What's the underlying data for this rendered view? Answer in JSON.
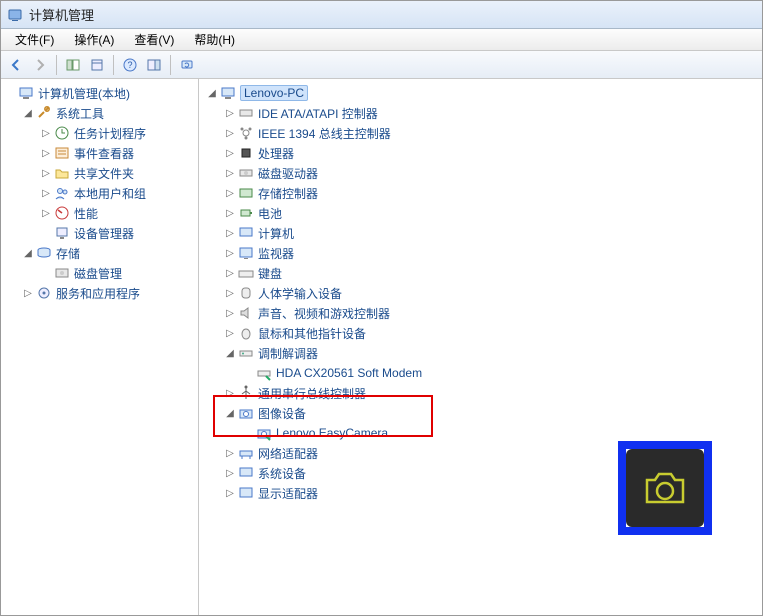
{
  "window": {
    "title": "计算机管理"
  },
  "menu": {
    "file": "文件(F)",
    "action": "操作(A)",
    "view": "查看(V)",
    "help": "帮助(H)"
  },
  "left": {
    "root": "计算机管理(本地)",
    "systools": "系统工具",
    "tasksched": "任务计划程序",
    "eventviewer": "事件查看器",
    "sharedfolders": "共享文件夹",
    "localusers": "本地用户和组",
    "performance": "性能",
    "devicemgr": "设备管理器",
    "storage": "存储",
    "diskmgmt": "磁盘管理",
    "services": "服务和应用程序"
  },
  "right": {
    "root": "Lenovo-PC",
    "ide": "IDE ATA/ATAPI 控制器",
    "ieee1394": "IEEE 1394 总线主控制器",
    "cpu": "处理器",
    "diskdrive": "磁盘驱动器",
    "storagectl": "存储控制器",
    "battery": "电池",
    "computer": "计算机",
    "monitor": "监视器",
    "keyboard": "键盘",
    "hid": "人体学输入设备",
    "sound": "声音、视频和游戏控制器",
    "mouse": "鼠标和其他指针设备",
    "modem": "调制解调器",
    "modem_item": "HDA CX20561 Soft Modem",
    "usb": "通用串行总线控制器",
    "imaging": "图像设备",
    "imaging_item": "Lenovo EasyCamera",
    "netadapter": "网络适配器",
    "sysdev": "系统设备",
    "display": "显示适配器"
  }
}
